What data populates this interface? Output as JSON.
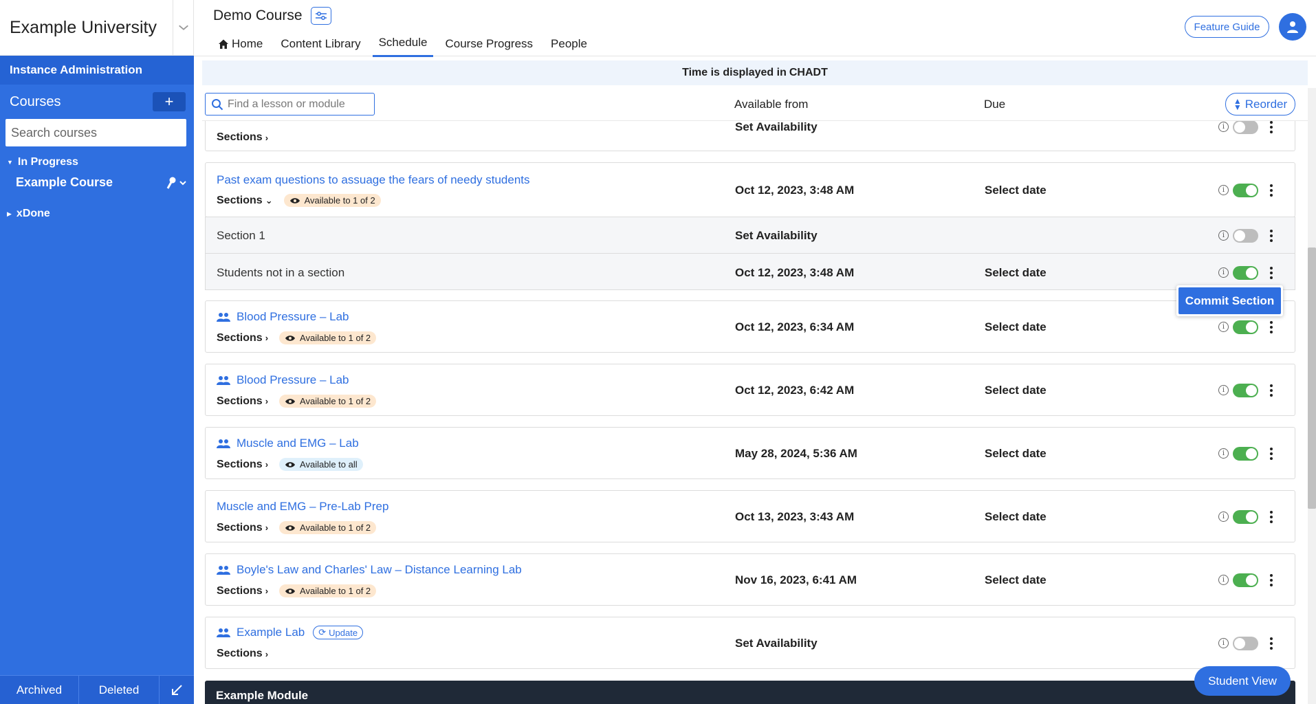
{
  "sidebar": {
    "university": "Example University",
    "admin_label": "Instance Administration",
    "courses_label": "Courses",
    "add_label": "+",
    "search_placeholder": "Search courses",
    "group_in_progress": "In Progress",
    "course_name": "Example Course",
    "group_done": "xDone",
    "footer": {
      "archived": "Archived",
      "deleted": "Deleted"
    }
  },
  "header": {
    "course_title": "Demo Course",
    "tabs": [
      "Home",
      "Content Library",
      "Schedule",
      "Course Progress",
      "People"
    ],
    "active_tab": "Schedule",
    "feature_guide": "Feature Guide"
  },
  "banner": {
    "prefix": "Time is displayed in",
    "timezone": "CHADT"
  },
  "table": {
    "search_placeholder": "Find a lesson or module",
    "col_available": "Available from",
    "col_due": "Due",
    "reorder": "Reorder"
  },
  "rows": [
    {
      "title": "",
      "sections": "Sections",
      "available": "Set Availability",
      "due": "",
      "enabled": false
    },
    {
      "title": "Past exam questions to assuage the fears of needy students",
      "sections": "Sections",
      "badge": "Available to 1 of 2",
      "available": "Oct 12, 2023, 3:48 AM",
      "due": "Select date",
      "enabled": true
    },
    {
      "title": "Section 1",
      "available": "Set Availability",
      "due": "",
      "enabled": false
    },
    {
      "title": "Students not in a section",
      "available": "Oct 12, 2023, 3:48 AM",
      "due": "Select date",
      "enabled": true
    },
    {
      "title": "Blood Pressure – Lab",
      "sections": "Sections",
      "badge": "Available to 1 of 2",
      "available": "Oct 12, 2023, 6:34 AM",
      "due": "Select date",
      "enabled": true
    },
    {
      "title": "Blood Pressure – Lab",
      "sections": "Sections",
      "badge": "Available to 1 of 2",
      "available": "Oct 12, 2023, 6:42 AM",
      "due": "Select date",
      "enabled": true
    },
    {
      "title": "Muscle and EMG – Lab",
      "sections": "Sections",
      "badge": "Available to all",
      "available": "May 28, 2024, 5:36 AM",
      "due": "Select date",
      "enabled": true
    },
    {
      "title": "Muscle and EMG – Pre-Lab Prep",
      "sections": "Sections",
      "badge": "Available to 1 of 2",
      "available": "Oct 13, 2023, 3:43 AM",
      "due": "Select date",
      "enabled": true
    },
    {
      "title": "Boyle's Law and Charles' Law – Distance Learning Lab",
      "sections": "Sections",
      "badge": "Available to 1 of 2",
      "available": "Nov 16, 2023, 6:41 AM",
      "due": "Select date",
      "enabled": true
    },
    {
      "title": "Example Lab",
      "update": "Update",
      "sections": "Sections",
      "available": "Set Availability",
      "due": "",
      "enabled": false
    }
  ],
  "popup": {
    "commit": "Commit Section"
  },
  "module": {
    "title": "Example Module"
  },
  "student_view": "Student View",
  "colors": {
    "accent": "#2f6fe0",
    "sidebar": "#2f6fe0",
    "toggle_on": "#4caf50",
    "module_bar": "#1f2937"
  }
}
